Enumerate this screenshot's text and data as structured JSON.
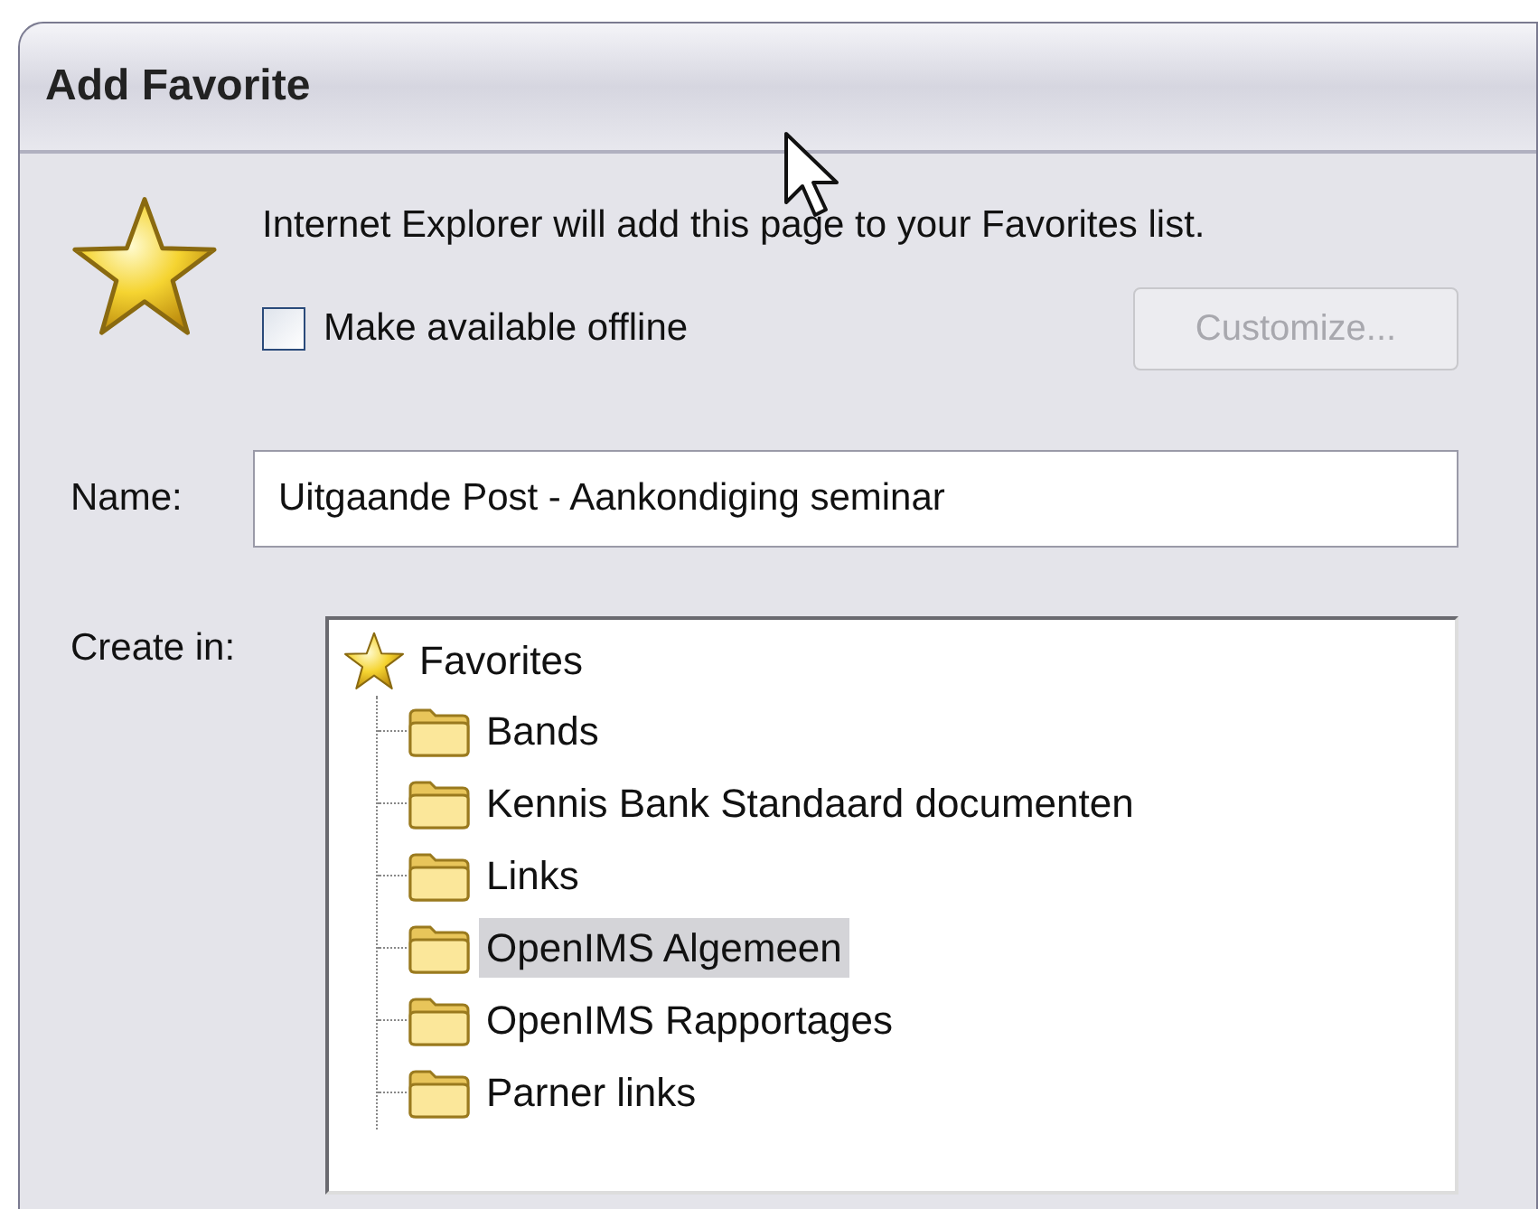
{
  "window": {
    "title": "Add Favorite"
  },
  "message": "Internet Explorer will add this page to your Favorites list.",
  "offline": {
    "label": "Make available offline",
    "checked": false
  },
  "customize_button": {
    "label": "Customize...",
    "disabled": true
  },
  "name": {
    "label": "Name:",
    "value": "Uitgaande Post - Aankondiging seminar"
  },
  "create_in": {
    "label": "Create in:",
    "tree": {
      "label": "Favorites",
      "kind": "favorites",
      "selected": false,
      "children": [
        {
          "label": "Bands",
          "kind": "folder",
          "selected": false
        },
        {
          "label": "Kennis Bank Standaard documenten",
          "kind": "folder",
          "selected": false
        },
        {
          "label": "Links",
          "kind": "folder",
          "selected": false
        },
        {
          "label": "OpenIMS Algemeen",
          "kind": "folder",
          "selected": true
        },
        {
          "label": "OpenIMS Rapportages",
          "kind": "folder",
          "selected": false
        },
        {
          "label": "Parner links",
          "kind": "folder",
          "selected": false
        }
      ]
    }
  }
}
